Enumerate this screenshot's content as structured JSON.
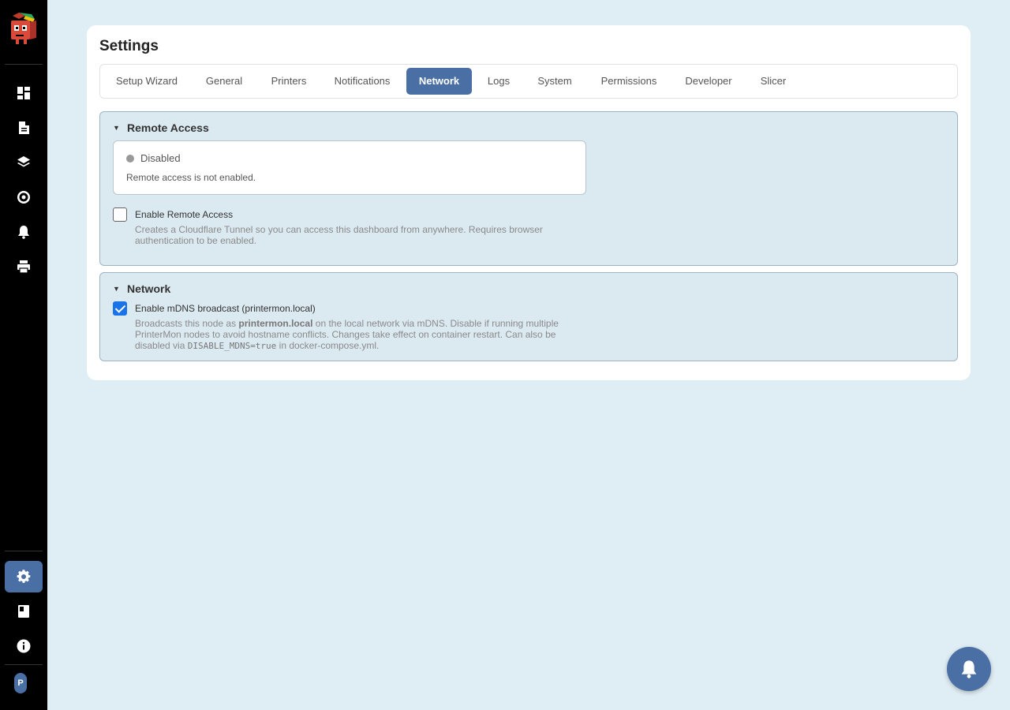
{
  "sidebar": {
    "nav_icons": [
      "dashboard-icon",
      "file-icon",
      "layers-icon",
      "spool-icon",
      "bell-icon",
      "printer-icon"
    ],
    "bottom_icons": [
      "gear-icon",
      "book-icon",
      "info-icon"
    ],
    "avatar_initial": "P"
  },
  "page": {
    "title": "Settings"
  },
  "tabs": [
    {
      "label": "Setup Wizard",
      "active": false
    },
    {
      "label": "General",
      "active": false
    },
    {
      "label": "Printers",
      "active": false
    },
    {
      "label": "Notifications",
      "active": false
    },
    {
      "label": "Network",
      "active": true
    },
    {
      "label": "Logs",
      "active": false
    },
    {
      "label": "System",
      "active": false
    },
    {
      "label": "Permissions",
      "active": false
    },
    {
      "label": "Developer",
      "active": false
    },
    {
      "label": "Slicer",
      "active": false
    }
  ],
  "remote_access": {
    "title": "Remote Access",
    "status_label": "Disabled",
    "status_desc": "Remote access is not enabled.",
    "status_color": "#999999",
    "enable_label": "Enable Remote Access",
    "enable_checked": false,
    "enable_help": "Creates a Cloudflare Tunnel so you can access this dashboard from anywhere. Requires browser authentication to be enabled."
  },
  "network": {
    "title": "Network",
    "mdns_label": "Enable mDNS broadcast (printermon.local)",
    "mdns_checked": true,
    "mdns_help_1": "Broadcasts this node as ",
    "mdns_help_host": "printermon.local",
    "mdns_help_2": " on the local network via mDNS. Disable if running multiple PrinterMon nodes to avoid hostname conflicts. Changes take effect on container restart. Can also be disabled via ",
    "mdns_help_code": "DISABLE_MDNS=true",
    "mdns_help_3": " in docker-compose.yml."
  },
  "colors": {
    "accent": "#4a6fa5",
    "section_bg": "#dbe9f1",
    "checkbox": "#1a73e8"
  }
}
